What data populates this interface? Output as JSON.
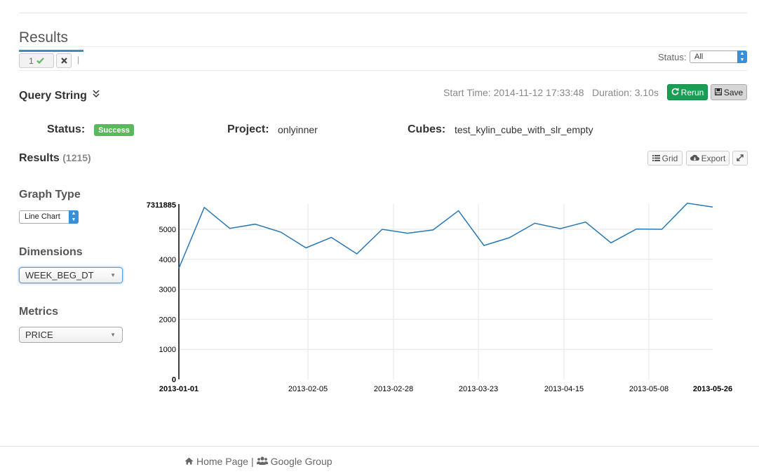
{
  "results_panel": {
    "title": "Results",
    "tab_number": "1",
    "tab_divider": "|",
    "status_filter_label": "Status:",
    "status_filter_value": "All"
  },
  "query": {
    "query_string_label": "Query String",
    "start_time": "Start Time: 2014-11-12 17:33:48",
    "duration": "Duration: 3.10s",
    "rerun_label": "Rerun",
    "save_label": "Save",
    "status_label": "Status:",
    "status_value": "Success",
    "project_label": "Project:",
    "project_value": "onlyinner",
    "cubes_label": "Cubes:",
    "cubes_value": "test_kylin_cube_with_slr_empty"
  },
  "results": {
    "label": "Results",
    "count": "(1215)",
    "grid_label": "Grid",
    "export_label": "Export"
  },
  "sidebar": {
    "graph_type_label": "Graph Type",
    "graph_type_value": "Line Chart",
    "dimensions_label": "Dimensions",
    "dimension_value": "WEEK_BEG_DT",
    "metrics_label": "Metrics",
    "metric_value": "PRICE"
  },
  "footer": {
    "home_label": "Home Page",
    "divider": "|",
    "group_label": "Google Group"
  },
  "colors": {
    "line": "#2878b4",
    "success_badge": "#5cb85c",
    "rerun_button": "#1a9e55",
    "select_accent": "#3a8fd9"
  },
  "icons": {
    "tab_status": "check-icon",
    "tab_close": "close-icon",
    "query_toggle": "double-chevron-down-icon",
    "rerun": "refresh-icon",
    "save": "floppy-icon",
    "grid": "list-icon",
    "export": "cloud-download-icon",
    "fullscreen": "expand-icon",
    "home": "home-icon",
    "group": "users-icon"
  },
  "chart_data": {
    "type": "line",
    "ylim": [
      0,
      7311885
    ],
    "y_ticks": [
      "0",
      "1000",
      "2000",
      "3000",
      "4000",
      "5000"
    ],
    "y_max_label": "7311885",
    "x_ticks": [
      "2013-01-01",
      "2013-02-05",
      "2013-02-28",
      "2013-03-23",
      "2013-04-15",
      "2013-05-08",
      "2013-05-26"
    ],
    "grid": true,
    "series": [
      {
        "values": [
          3700,
          5730,
          5030,
          5170,
          4910,
          4380,
          4730,
          4180,
          5000,
          4870,
          4980,
          5620,
          4460,
          4720,
          5200,
          5020,
          5240,
          4550,
          5010,
          5000,
          5870,
          5740
        ]
      }
    ]
  }
}
